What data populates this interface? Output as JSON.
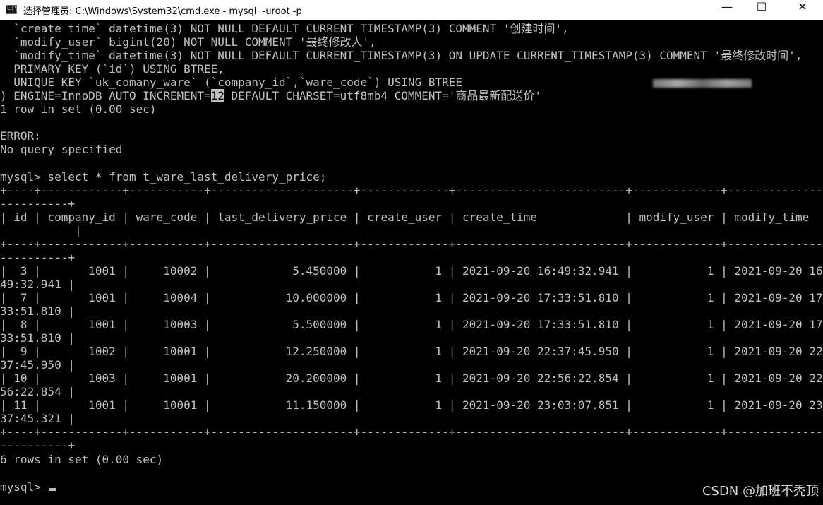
{
  "window": {
    "title": "选择管理员: C:\\Windows\\System32\\cmd.exe - mysql  -uroot -p",
    "minimize_glyph": "—",
    "maximize_glyph": "☐",
    "close_glyph": "✕"
  },
  "terminal": {
    "lines": [
      "  `create_time` datetime(3) NOT NULL DEFAULT CURRENT_TIMESTAMP(3) COMMENT '创建时间',",
      "  `modify_user` bigint(20) NOT NULL COMMENT '最终修改人',",
      "  `modify_time` datetime(3) NOT NULL DEFAULT CURRENT_TIMESTAMP(3) ON UPDATE CURRENT_TIMESTAMP(3) COMMENT '最终修改时间',",
      "  PRIMARY KEY (`id`) USING BTREE,",
      "  UNIQUE KEY `uk_comany_ware` (`company_id`,`ware_code`) USING BTREE"
    ],
    "engine_prefix": ") ENGINE=InnoDB AUTO_INCREMENT=",
    "engine_selected": "12",
    "engine_suffix": " DEFAULT CHARSET=utf8mb4 COMMENT='商品最新配送价'",
    "row_count_1": "1 row in set (0.00 sec)",
    "error_label": "ERROR:",
    "error_message": "No query specified",
    "query": "mysql> select * from t_ware_last_delivery_price;",
    "border_line": "+----+------------+-----------+---------------------+-------------+-------------------------+-------------+----------------",
    "border_wrap": "----------+",
    "header_line": "| id | company_id | ware_code | last_delivery_price | create_user | create_time             | modify_user | modify_time",
    "header_wrap": "           |",
    "rows": [
      {
        "main": "|  3 |       1001 |     10002 |            5.450000 |           1 | 2021-09-20 16:49:32.941 |           1 | 2021-09-20 16:",
        "wrap": "49:32.941 |"
      },
      {
        "main": "|  7 |       1001 |     10004 |           10.000000 |           1 | 2021-09-20 17:33:51.810 |           1 | 2021-09-20 17:",
        "wrap": "33:51.810 |"
      },
      {
        "main": "|  8 |       1001 |     10003 |            5.500000 |           1 | 2021-09-20 17:33:51.810 |           1 | 2021-09-20 17:",
        "wrap": "33:51.810 |"
      },
      {
        "main": "|  9 |       1002 |     10001 |           12.250000 |           1 | 2021-09-20 22:37:45.950 |           1 | 2021-09-20 22:",
        "wrap": "37:45.950 |"
      },
      {
        "main": "| 10 |       1003 |     10001 |           20.200000 |           1 | 2021-09-20 22:56:22.854 |           1 | 2021-09-20 22:",
        "wrap": "56:22.854 |"
      },
      {
        "main": "| 11 |       1001 |     10001 |           11.150000 |           1 | 2021-09-20 23:03:07.851 |           1 | 2021-09-20 23:",
        "wrap": "37:45.321 |"
      }
    ],
    "row_count_6": "6 rows in set (0.00 sec)",
    "prompt": "mysql> "
  },
  "watermark": "CSDN @加班不秃顶"
}
